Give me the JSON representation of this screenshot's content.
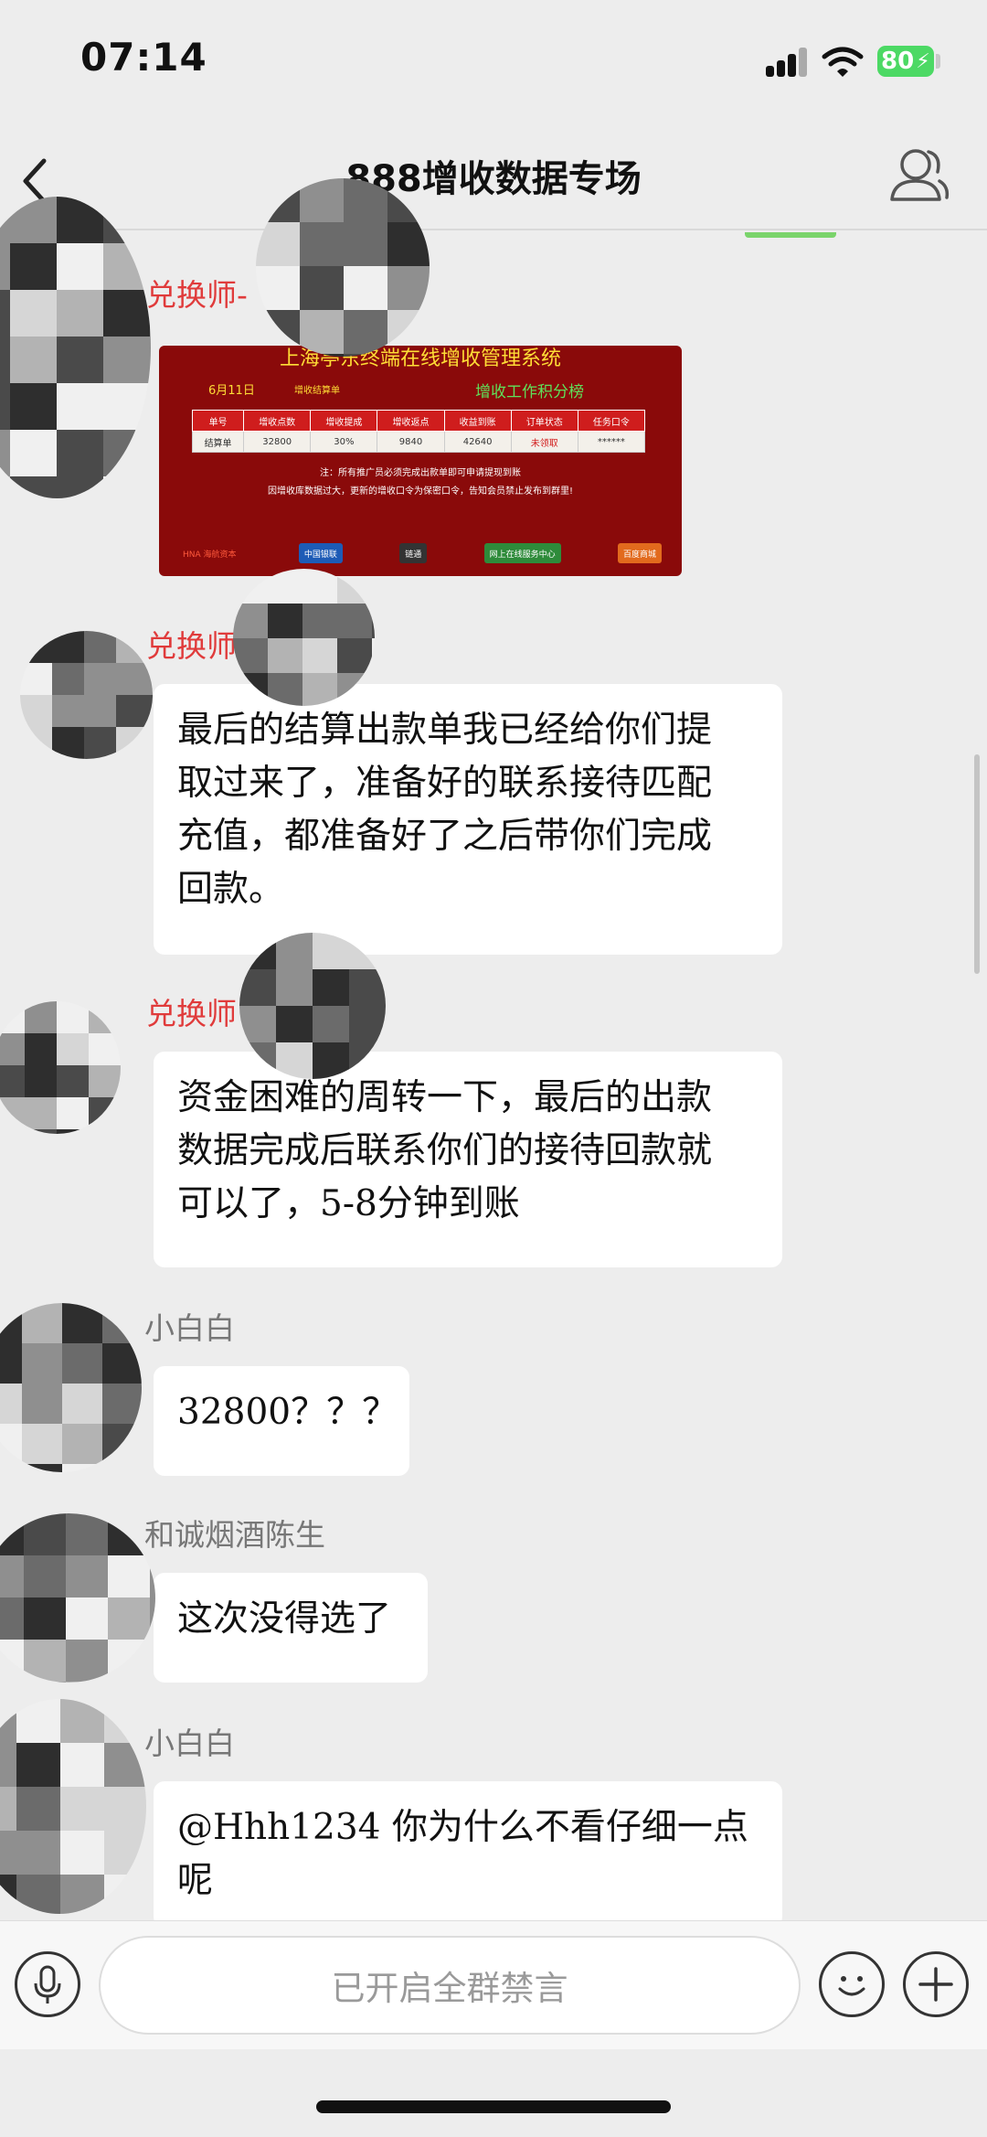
{
  "status_bar": {
    "time": "07:14",
    "battery": "80"
  },
  "nav": {
    "title": "888增收数据专场",
    "back_icon": "chevron-left-icon",
    "members_icon": "person-icon"
  },
  "shared_image": {
    "title": "上海亭东终端在线增收管理系统",
    "date": "6月11日",
    "subtitle": "增收结算单",
    "board": "增收工作积分榜",
    "table": {
      "headers": [
        "单号",
        "增收点数",
        "增收提成",
        "增收返点",
        "收益到账",
        "订单状态",
        "任务口令"
      ],
      "rows": [
        [
          "结算单",
          "32800",
          "30%",
          "9840",
          "42640",
          "未领取",
          "******"
        ]
      ]
    },
    "note1": "注：所有推广员必须完成出款单即可申请提现到账",
    "note2": "因增收库数据过大，更新的增收口令为保密口令，告知会员禁止发布到群里!",
    "logos": [
      "HNA 海航资本",
      "中国银联",
      "链通",
      "网上在线服务中心",
      "百度商城"
    ]
  },
  "messages": [
    {
      "sender": "兑换师-",
      "type": "image"
    },
    {
      "sender": "兑换师",
      "type": "text",
      "lines": [
        "最后的结算出款单我已经给你们提",
        "取过来了，准备好的联系接待匹配",
        "充值，都准备好了之后带你们完成",
        "回款。"
      ]
    },
    {
      "sender": "兑换师",
      "type": "text",
      "lines": [
        "资金困难的周转一下，最后的出款",
        "数据完成后联系你们的接待回款就",
        "可以了，5-8分钟到账"
      ]
    },
    {
      "sender": "小白白",
      "type": "text",
      "lines": [
        "32800？？？"
      ]
    },
    {
      "sender": "和诚烟酒陈生",
      "type": "text",
      "lines": [
        "这次没得选了"
      ]
    },
    {
      "sender": "小白白",
      "type": "text",
      "lines": [
        "@Hhh1234 你为什么不看仔细一点",
        "呢"
      ]
    }
  ],
  "input_bar": {
    "muted_text": "已开启全群禁言",
    "voice_icon": "microphone-icon",
    "emoji_icon": "smiley-icon",
    "plus_icon": "plus-icon"
  },
  "colors": {
    "sender_red": "#e03b3b",
    "sender_gray": "#777777",
    "background": "#ededed",
    "battery": "#4cd964"
  }
}
